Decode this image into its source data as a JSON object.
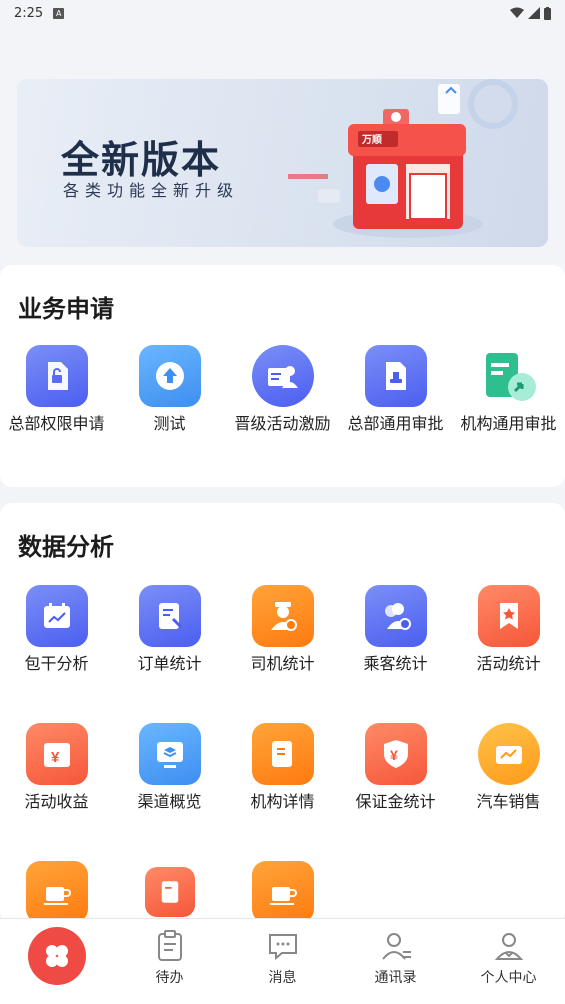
{
  "status_bar": {
    "time": "2:25",
    "badge": "A"
  },
  "banner": {
    "title": "全新版本",
    "subtitle": "各类功能全新升级",
    "brand": "万顺"
  },
  "business": {
    "title": "业务申请",
    "items": [
      {
        "label": "总部权限申请",
        "icon": "lock-doc-icon"
      },
      {
        "label": "测试",
        "icon": "upload-icon"
      },
      {
        "label": "晋级活动激励",
        "icon": "user-card-icon"
      },
      {
        "label": "总部通用审批",
        "icon": "stamp-doc-icon"
      },
      {
        "label": "机构通用审批",
        "icon": "org-approve-icon"
      }
    ]
  },
  "analysis": {
    "title": "数据分析",
    "items": [
      {
        "label": "包干分析",
        "icon": "calendar-chart-icon"
      },
      {
        "label": "订单统计",
        "icon": "order-doc-icon"
      },
      {
        "label": "司机统计",
        "icon": "driver-icon"
      },
      {
        "label": "乘客统计",
        "icon": "passenger-icon"
      },
      {
        "label": "活动统计",
        "icon": "bookmark-star-icon"
      },
      {
        "label": "活动收益",
        "icon": "yuan-box-icon"
      },
      {
        "label": "渠道概览",
        "icon": "monitor-layers-icon"
      },
      {
        "label": "机构详情",
        "icon": "org-doc-icon"
      },
      {
        "label": "保证金统计",
        "icon": "yuan-shield-icon"
      },
      {
        "label": "汽车销售",
        "icon": "car-sales-icon"
      },
      {
        "label": "",
        "icon": "cup-icon"
      },
      {
        "label": "",
        "icon": "doc-icon"
      },
      {
        "label": "",
        "icon": "cup-icon"
      }
    ]
  },
  "tabbar": {
    "items": [
      {
        "label": "",
        "icon": "home-clover-icon"
      },
      {
        "label": "待办",
        "icon": "todo-icon"
      },
      {
        "label": "消息",
        "icon": "message-icon"
      },
      {
        "label": "通讯录",
        "icon": "contacts-icon"
      },
      {
        "label": "个人中心",
        "icon": "profile-icon"
      }
    ]
  },
  "colors": {
    "accent_red": "#f04a44",
    "blue": "#4b5ef0",
    "orange": "#ff7a10"
  }
}
